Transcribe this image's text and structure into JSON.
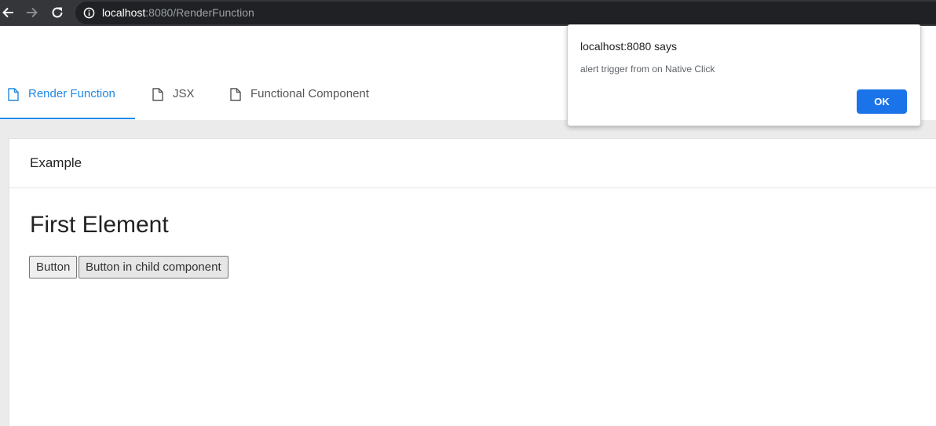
{
  "browser": {
    "url_host": "localhost",
    "url_rest": ":8080/RenderFunction",
    "icons": [
      "back-arrow-icon",
      "forward-arrow-icon",
      "reload-icon",
      "info-icon"
    ]
  },
  "tabs": [
    {
      "label": "Render Function",
      "active": true,
      "icon": "file-icon"
    },
    {
      "label": "JSX",
      "active": false,
      "icon": "file-icon"
    },
    {
      "label": "Functional Component",
      "active": false,
      "icon": "file-icon"
    }
  ],
  "card": {
    "title": "Example",
    "heading": "First Element",
    "button_label": "Button",
    "child_button_label": "Button in child component"
  },
  "dialog": {
    "title": "localhost:8080 says",
    "message": "alert trigger from on Native Click",
    "ok_label": "OK"
  },
  "colors": {
    "accent": "#1e88e5",
    "dialog_button": "#1a73e8",
    "toolbar": "#35363a",
    "content_bg": "#ebebeb"
  }
}
